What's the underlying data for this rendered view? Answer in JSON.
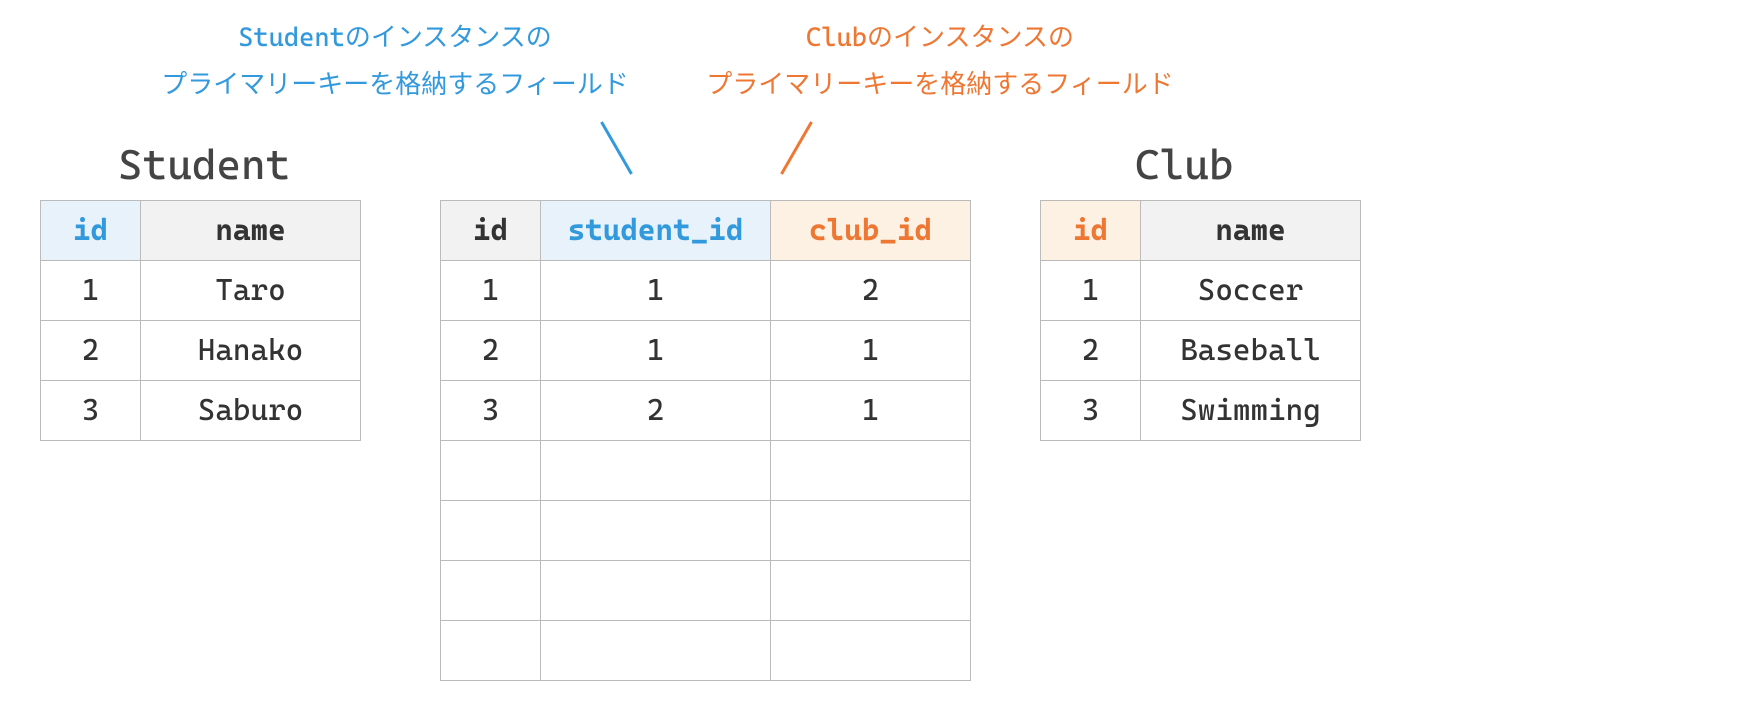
{
  "annotations": {
    "blue_line1": "Studentのインスタンスの",
    "blue_line2": "プライマリーキーを格納するフィールド",
    "orange_line1": "Clubのインスタンスの",
    "orange_line2": "プライマリーキーを格納するフィールド"
  },
  "tables": {
    "student": {
      "title": "Student",
      "headers": {
        "id": "id",
        "name": "name"
      },
      "rows": [
        {
          "id": "1",
          "name": "Taro"
        },
        {
          "id": "2",
          "name": "Hanako"
        },
        {
          "id": "3",
          "name": "Saburo"
        }
      ]
    },
    "junction": {
      "headers": {
        "id": "id",
        "student_id": "student_id",
        "club_id": "club_id"
      },
      "rows": [
        {
          "id": "1",
          "student_id": "1",
          "club_id": "2"
        },
        {
          "id": "2",
          "student_id": "1",
          "club_id": "1"
        },
        {
          "id": "3",
          "student_id": "2",
          "club_id": "1"
        }
      ]
    },
    "club": {
      "title": "Club",
      "headers": {
        "id": "id",
        "name": "name"
      },
      "rows": [
        {
          "id": "1",
          "name": "Soccer"
        },
        {
          "id": "2",
          "name": "Baseball"
        },
        {
          "id": "3",
          "name": "Swimming"
        }
      ]
    }
  }
}
